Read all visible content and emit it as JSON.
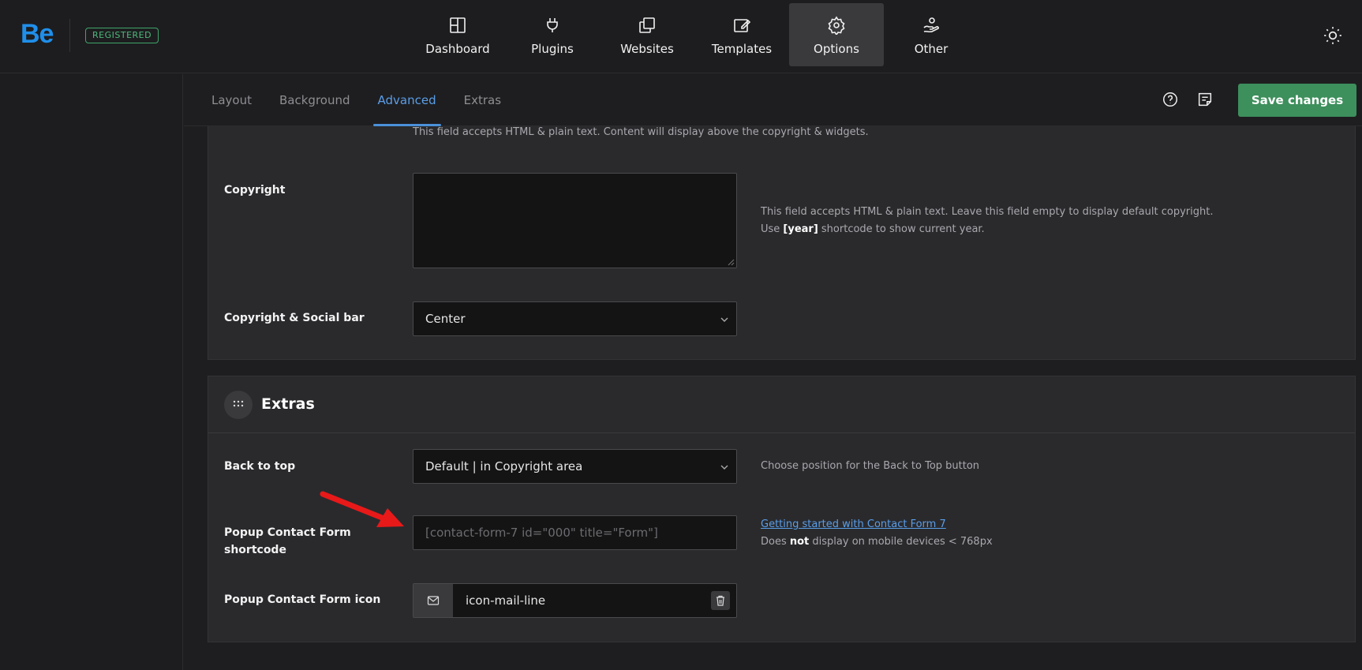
{
  "brand": {
    "logo": "Be",
    "badge": "REGISTERED"
  },
  "nav": [
    {
      "label": "Dashboard",
      "icon": "dashboard-icon"
    },
    {
      "label": "Plugins",
      "icon": "plug-icon"
    },
    {
      "label": "Websites",
      "icon": "websites-icon"
    },
    {
      "label": "Templates",
      "icon": "templates-icon"
    },
    {
      "label": "Options",
      "icon": "gear-icon",
      "active": true
    },
    {
      "label": "Other",
      "icon": "hand-icon"
    }
  ],
  "tabs": [
    {
      "label": "Layout"
    },
    {
      "label": "Background"
    },
    {
      "label": "Advanced",
      "active": true
    },
    {
      "label": "Extras"
    }
  ],
  "toolbar": {
    "save_label": "Save changes"
  },
  "footer_section": {
    "top_help": "This field accepts HTML & plain text. Content will display above the copyright & widgets.",
    "copyright": {
      "label": "Copyright",
      "value": "",
      "help_line1": "This field accepts HTML & plain text. Leave this field empty to display default copyright.",
      "help_line2_pre": "Use ",
      "help_line2_code": "[year]",
      "help_line2_post": " shortcode to show current year."
    },
    "social_bar": {
      "label": "Copyright & Social bar",
      "value": "Center"
    }
  },
  "extras_section": {
    "title": "Extras",
    "back_to_top": {
      "label": "Back to top",
      "value": "Default | in Copyright area",
      "help": "Choose position for the Back to Top button"
    },
    "popup_shortcode": {
      "label_line1": "Popup Contact Form",
      "label_line2": "shortcode",
      "value": "",
      "placeholder": "[contact-form-7 id=\"000\" title=\"Form\"]",
      "link": "Getting started with Contact Form 7",
      "help_pre": "Does ",
      "help_bold": "not",
      "help_post": " display on mobile devices < 768px"
    },
    "popup_icon": {
      "label": "Popup Contact Form icon",
      "value": "icon-mail-line"
    }
  },
  "colors": {
    "accent": "#4a90d9",
    "save": "#3d8f5c",
    "badge": "#4fb97d",
    "annotation_arrow": "#e81919"
  }
}
